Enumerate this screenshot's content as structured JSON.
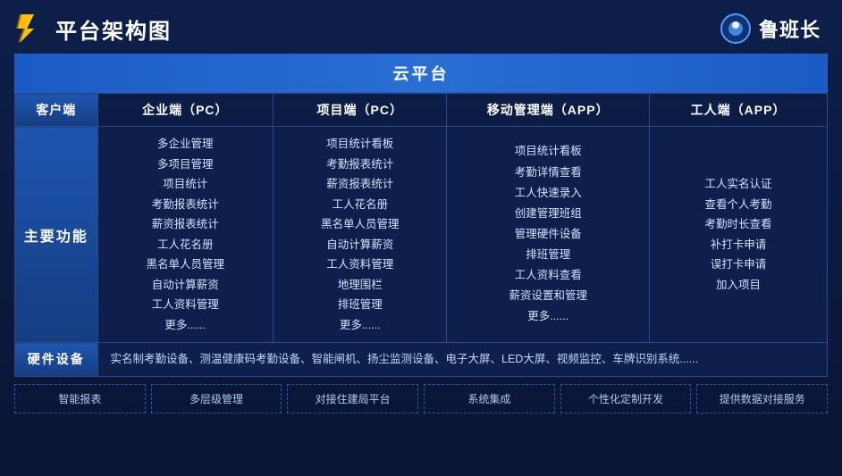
{
  "header": {
    "title": "平台架构图",
    "brand": "鲁班长"
  },
  "cloud_platform": {
    "label": "云平台"
  },
  "columns": {
    "client": "客户端",
    "enterprise": "企业端（PC）",
    "project": "项目端（PC）",
    "mobile": "移动管理端（APP）",
    "worker": "工人端（APP）"
  },
  "rows": {
    "main_function": {
      "label": "主要功能",
      "enterprise_items": [
        "多企业管理",
        "多项目管理",
        "项目统计",
        "考勤报表统计",
        "薪资报表统计",
        "工人花名册",
        "黑名单人员管理",
        "自动计算薪资",
        "工人资料管理",
        "更多......"
      ],
      "project_items": [
        "项目统计看板",
        "考勤报表统计",
        "薪资报表统计",
        "工人花名册",
        "黑名单人员管理",
        "自动计算薪资",
        "工人资料管理",
        "地理围栏",
        "排班管理",
        "更多......"
      ],
      "mobile_items": [
        "项目统计看板",
        "考勤详情查看",
        "工人快速录入",
        "创建管理班组",
        "管理硬件设备",
        "排班管理",
        "工人资料查看",
        "薪资设置和管理",
        "更多......"
      ],
      "worker_items": [
        "工人实名认证",
        "查看个人考勤",
        "考勤时长查看",
        "补打卡申请",
        "误打卡申请",
        "加入项目"
      ]
    },
    "hardware": {
      "label": "硬件设备",
      "content": "实名制考勤设备、测温健康码考勤设备、智能闸机、扬尘监测设备、电子大屏、LED大屏、视频监控、车牌识别系统......"
    }
  },
  "features": [
    "智能报表",
    "多层级管理",
    "对接住建局平台",
    "系统集成",
    "个性化定制开发",
    "提供数据对接服务"
  ]
}
